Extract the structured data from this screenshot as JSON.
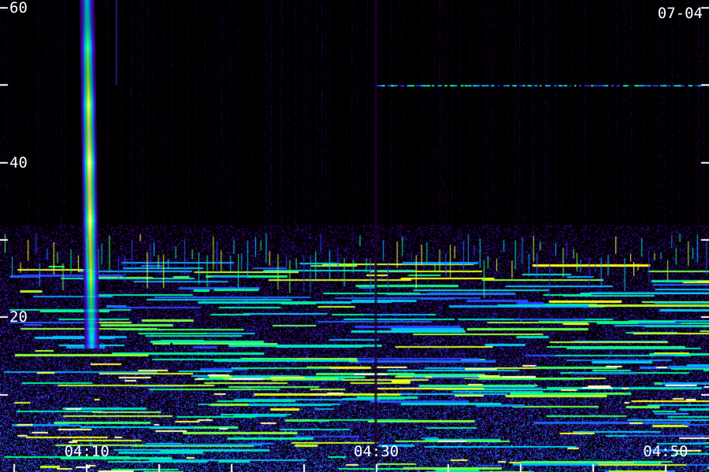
{
  "chart_data": {
    "type": "heatmap",
    "title": "",
    "xlabel": "",
    "ylabel": "",
    "date_label": "07-04",
    "x_ticks": [
      "04:10",
      "04:30",
      "04:50"
    ],
    "x_range": [
      "04:04",
      "04:53"
    ],
    "y_ticks": [
      20,
      40,
      60
    ],
    "y_range": [
      0,
      61
    ],
    "colormap": [
      "#2a0040",
      "#4b00a0",
      "#3030ff",
      "#00c8ff",
      "#00ff80",
      "#ffff00",
      "#ffffff"
    ],
    "features": [
      {
        "kind": "vertical-band",
        "time": "04:10",
        "from": 16,
        "to": 61,
        "intensity": "high"
      },
      {
        "kind": "horizontal-line",
        "value": 50,
        "from_time": "04:30",
        "to_time": "04:53",
        "intensity": "low"
      },
      {
        "kind": "noise-band",
        "from": 0,
        "to": 32,
        "intensity": "medium"
      }
    ]
  }
}
